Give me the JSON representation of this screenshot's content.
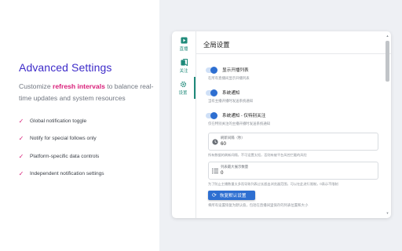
{
  "hero": {
    "title": "Advanced Settings",
    "desc_before": "Customize ",
    "desc_accent": "refresh intervals",
    "desc_after": " to balance real-time updates and system resources",
    "features": [
      "Global notification toggle",
      "Notify for special follows only",
      "Platform-specific data controls",
      "Independent notification settings"
    ]
  },
  "rail": {
    "items": [
      {
        "label": "直播",
        "icon": "play-icon"
      },
      {
        "label": "关注",
        "icon": "bookmark-icon"
      },
      {
        "label": "设置",
        "icon": "gear-icon"
      }
    ],
    "active": "设置"
  },
  "settings": {
    "title": "全局设置",
    "toggles": [
      {
        "label": "显示开播列表",
        "hint": "在所有直播间显示开播列表",
        "on": true
      },
      {
        "label": "系统通知",
        "hint": "当有主播开播时发送系统通知",
        "on": true
      },
      {
        "label": "系统通知 - 仅特别关注",
        "hint": "仅在特别关注的主播开播时发送系统通知",
        "on": true
      }
    ],
    "refresh": {
      "label": "刷新间隔（秒）",
      "value": "60",
      "hint": "所有数据的刷新间隔，不可设置太短，否则有被平台风控拦截的风险"
    },
    "max_count": {
      "label": "列表最大展示数量",
      "value": "0",
      "hint": "为了防止主播数量太多而导致列表过长超出浏览器范围，可以在此进行限制，0表示不限制"
    },
    "reset": {
      "label": "恢复默认设置",
      "hint": "将所有设置恢复为默认值，包括在直播间里保存的列表位置和大小"
    }
  },
  "colors": {
    "accent": "#3d2bc9",
    "highlight": "#d9207a",
    "primary": "#2e6fd1",
    "rail": "#1f8a7a"
  }
}
